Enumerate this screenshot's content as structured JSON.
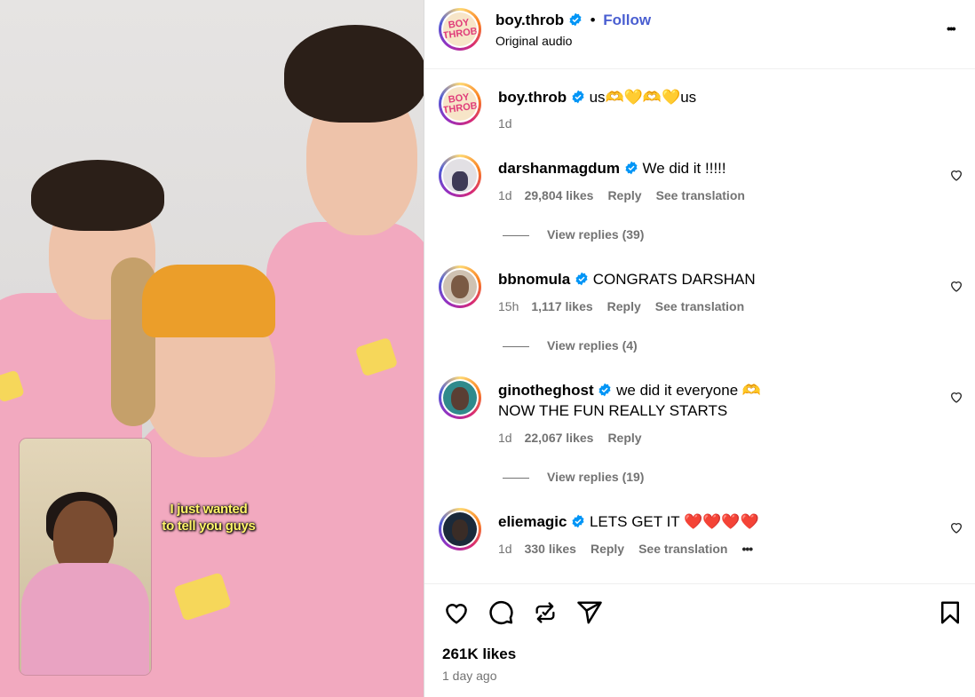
{
  "post": {
    "username": "boy.throb",
    "follow_label": "Follow",
    "separator": "•",
    "audio": "Original audio",
    "logo_text": "BOY THROB",
    "more_label": "•••"
  },
  "caption": {
    "username": "boy.throb",
    "text": "us🫶💛🫶💛us",
    "time": "1d"
  },
  "video": {
    "subtitle_line1": "I just wanted",
    "subtitle_line2": "to tell you guys"
  },
  "comments": [
    {
      "username": "darshanmagdum",
      "text": "We did it !!!!!",
      "time": "1d",
      "likes": "29,804 likes",
      "reply": "Reply",
      "translate": "See translation",
      "view_replies": "View replies (39)"
    },
    {
      "username": "bbnomula",
      "text": "CONGRATS DARSHAN",
      "time": "15h",
      "likes": "1,117 likes",
      "reply": "Reply",
      "translate": "See translation",
      "view_replies": "View replies (4)"
    },
    {
      "username": "ginotheghost",
      "text": "we did it everyone 🫶",
      "text2": "NOW THE FUN REALLY STARTS",
      "time": "1d",
      "likes": "22,067 likes",
      "reply": "Reply",
      "view_replies": "View replies (19)"
    },
    {
      "username": "eliemagic",
      "text": "LETS GET IT ❤️❤️❤️❤️",
      "time": "1d",
      "likes": "330 likes",
      "reply": "Reply",
      "translate": "See translation",
      "more": "•••"
    }
  ],
  "footer": {
    "likes": "261K likes",
    "ago": "1 day ago"
  },
  "colors": {
    "follow": "#0095f6",
    "verified": "#0095f6",
    "muted": "#737373"
  }
}
